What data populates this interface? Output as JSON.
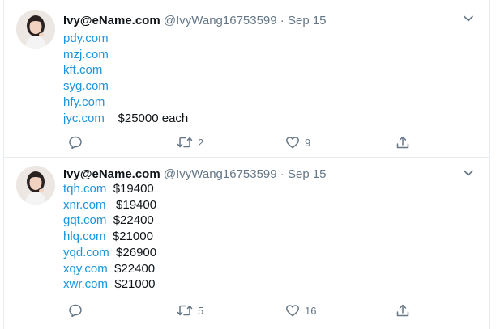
{
  "tweets": [
    {
      "author": {
        "name": "Ivy@eName.com",
        "handle": "@IvyWang16753599",
        "date": "Sep 15",
        "separator": "·"
      },
      "lines": [
        {
          "link": "pdy.com",
          "price": ""
        },
        {
          "link": "mzj.com",
          "price": ""
        },
        {
          "link": "kft.com",
          "price": ""
        },
        {
          "link": "syg.com",
          "price": ""
        },
        {
          "link": "hfy.com",
          "price": ""
        },
        {
          "link": "jyc.com",
          "price": "$25000 each"
        }
      ],
      "actions": {
        "reply_count": "",
        "retweet_count": "2",
        "like_count": "9"
      },
      "icons": [
        "reply-icon",
        "retweet-icon",
        "like-icon",
        "share-icon",
        "chevron-down-icon"
      ]
    },
    {
      "author": {
        "name": "Ivy@eName.com",
        "handle": "@IvyWang16753599",
        "date": "Sep 15",
        "separator": "·"
      },
      "lines": [
        {
          "link": "tqh.com",
          "price": "$19400"
        },
        {
          "link": "xnr.com",
          "price": "$19400"
        },
        {
          "link": "gqt.com",
          "price": "$22400"
        },
        {
          "link": "hlq.com",
          "price": "$21000"
        },
        {
          "link": "yqd.com",
          "price": "$26900"
        },
        {
          "link": "xqy.com",
          "price": "$22400"
        },
        {
          "link": "xwr.com",
          "price": "$21000"
        }
      ],
      "actions": {
        "reply_count": "",
        "retweet_count": "5",
        "like_count": "16"
      },
      "icons": [
        "reply-icon",
        "retweet-icon",
        "like-icon",
        "share-icon",
        "chevron-down-icon"
      ]
    }
  ],
  "colors": {
    "link": "#1b95e0",
    "muted": "#657786",
    "text": "#0f1419",
    "divider": "#e6ecf0"
  }
}
